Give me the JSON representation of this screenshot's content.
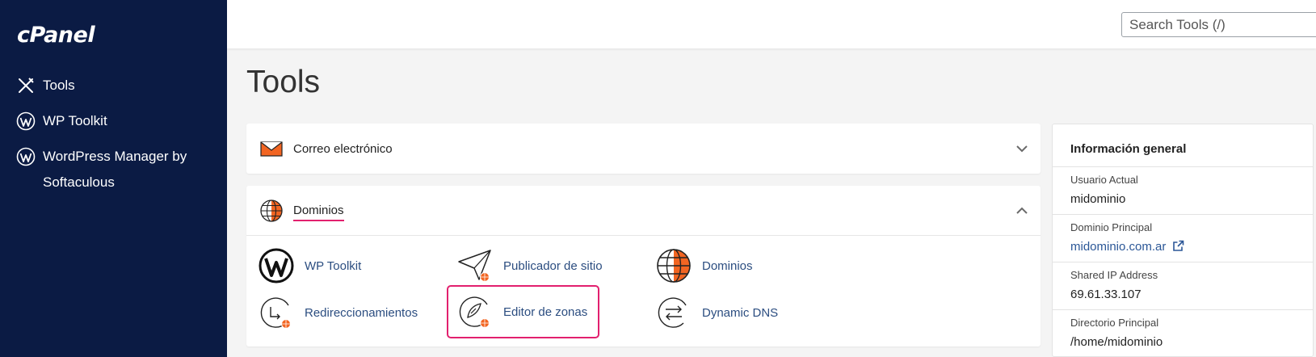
{
  "sidebar": {
    "logo": "cPanel",
    "items": [
      {
        "label": "Tools",
        "icon": "tools-icon"
      },
      {
        "label": "WP Toolkit",
        "icon": "wordpress-icon"
      },
      {
        "label": "WordPress Manager by Softaculous",
        "icon": "wordpress-icon"
      }
    ]
  },
  "header": {
    "search_placeholder": "Search Tools (/)"
  },
  "main": {
    "title": "Tools",
    "panels": [
      {
        "title": "Correo electrónico",
        "icon": "envelope-icon",
        "expanded": false
      },
      {
        "title": "Dominios",
        "icon": "globe-icon",
        "expanded": true,
        "tools": [
          {
            "label": "WP Toolkit",
            "icon": "wordpress-icon"
          },
          {
            "label": "Publicador de sitio",
            "icon": "paper-plane-icon"
          },
          {
            "label": "Dominios",
            "icon": "globe-icon"
          },
          {
            "label": "Redireccionamientos",
            "icon": "redirect-icon"
          },
          {
            "label": "Editor de zonas",
            "icon": "zone-editor-icon",
            "highlighted": true
          },
          {
            "label": "Dynamic DNS",
            "icon": "dynamic-dns-icon"
          }
        ]
      }
    ]
  },
  "info": {
    "title": "Información general",
    "rows": [
      {
        "label": "Usuario Actual",
        "value": "midominio"
      },
      {
        "label": "Dominio Principal",
        "value": "midominio.com.ar",
        "icon": "external-link-icon"
      },
      {
        "label": "Shared IP Address",
        "value": "69.61.33.107"
      },
      {
        "label": "Directorio Principal",
        "value": "/home/midominio"
      }
    ]
  },
  "colors": {
    "sidebar_bg": "#0b1b44",
    "accent_pink": "#e2206e",
    "icon_orange": "#f26522",
    "link_blue": "#2b4d80"
  }
}
